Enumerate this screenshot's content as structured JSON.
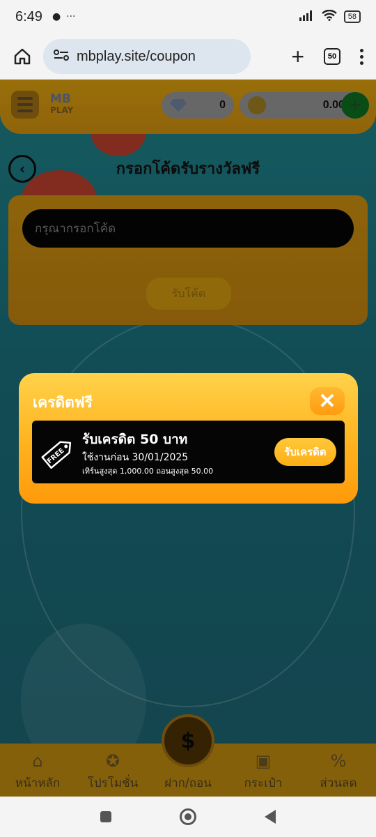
{
  "status_bar": {
    "time": "6:49",
    "dots": "···",
    "battery": "58"
  },
  "browser": {
    "url": "mbplay.site/coupon",
    "tab_count": "50"
  },
  "site_header": {
    "logo_main": "MB",
    "logo_sub": "PLAY",
    "gem_balance": "0",
    "coin_balance": "0.00"
  },
  "page": {
    "title": "กรอกโค้ดรับรางวัลฟรี",
    "coupon_placeholder": "กรุณากรอกโค้ด",
    "claim_code_label": "รับโค้ด"
  },
  "modal": {
    "title": "เครดิตฟรี",
    "items": [
      {
        "tag": "FREE",
        "title": "รับเครดิต 50 บาท",
        "expiry": "ใช้งานก่อน 30/01/2025",
        "limits": "เทิร์นสูงสุด 1,000.00 ถอนสูงสุด 50.00",
        "button_label": "รับเครดิต"
      }
    ]
  },
  "bottom_nav": {
    "items": [
      {
        "label": "หน้าหลัก",
        "icon": "home-icon"
      },
      {
        "label": "โปรโมชั่น",
        "icon": "promotion-icon"
      },
      {
        "label": "ฝาก/ถอน",
        "icon": "deposit-withdraw-icon"
      },
      {
        "label": "กระเป๋า",
        "icon": "wallet-icon"
      },
      {
        "label": "ส่วนลด",
        "icon": "discount-icon"
      }
    ]
  },
  "colors": {
    "modal_gradient_top": "#ffd24a",
    "modal_gradient_bottom": "#ff9a0a",
    "accent_gold": "#ffb21e",
    "page_teal": "#1d7f86"
  }
}
